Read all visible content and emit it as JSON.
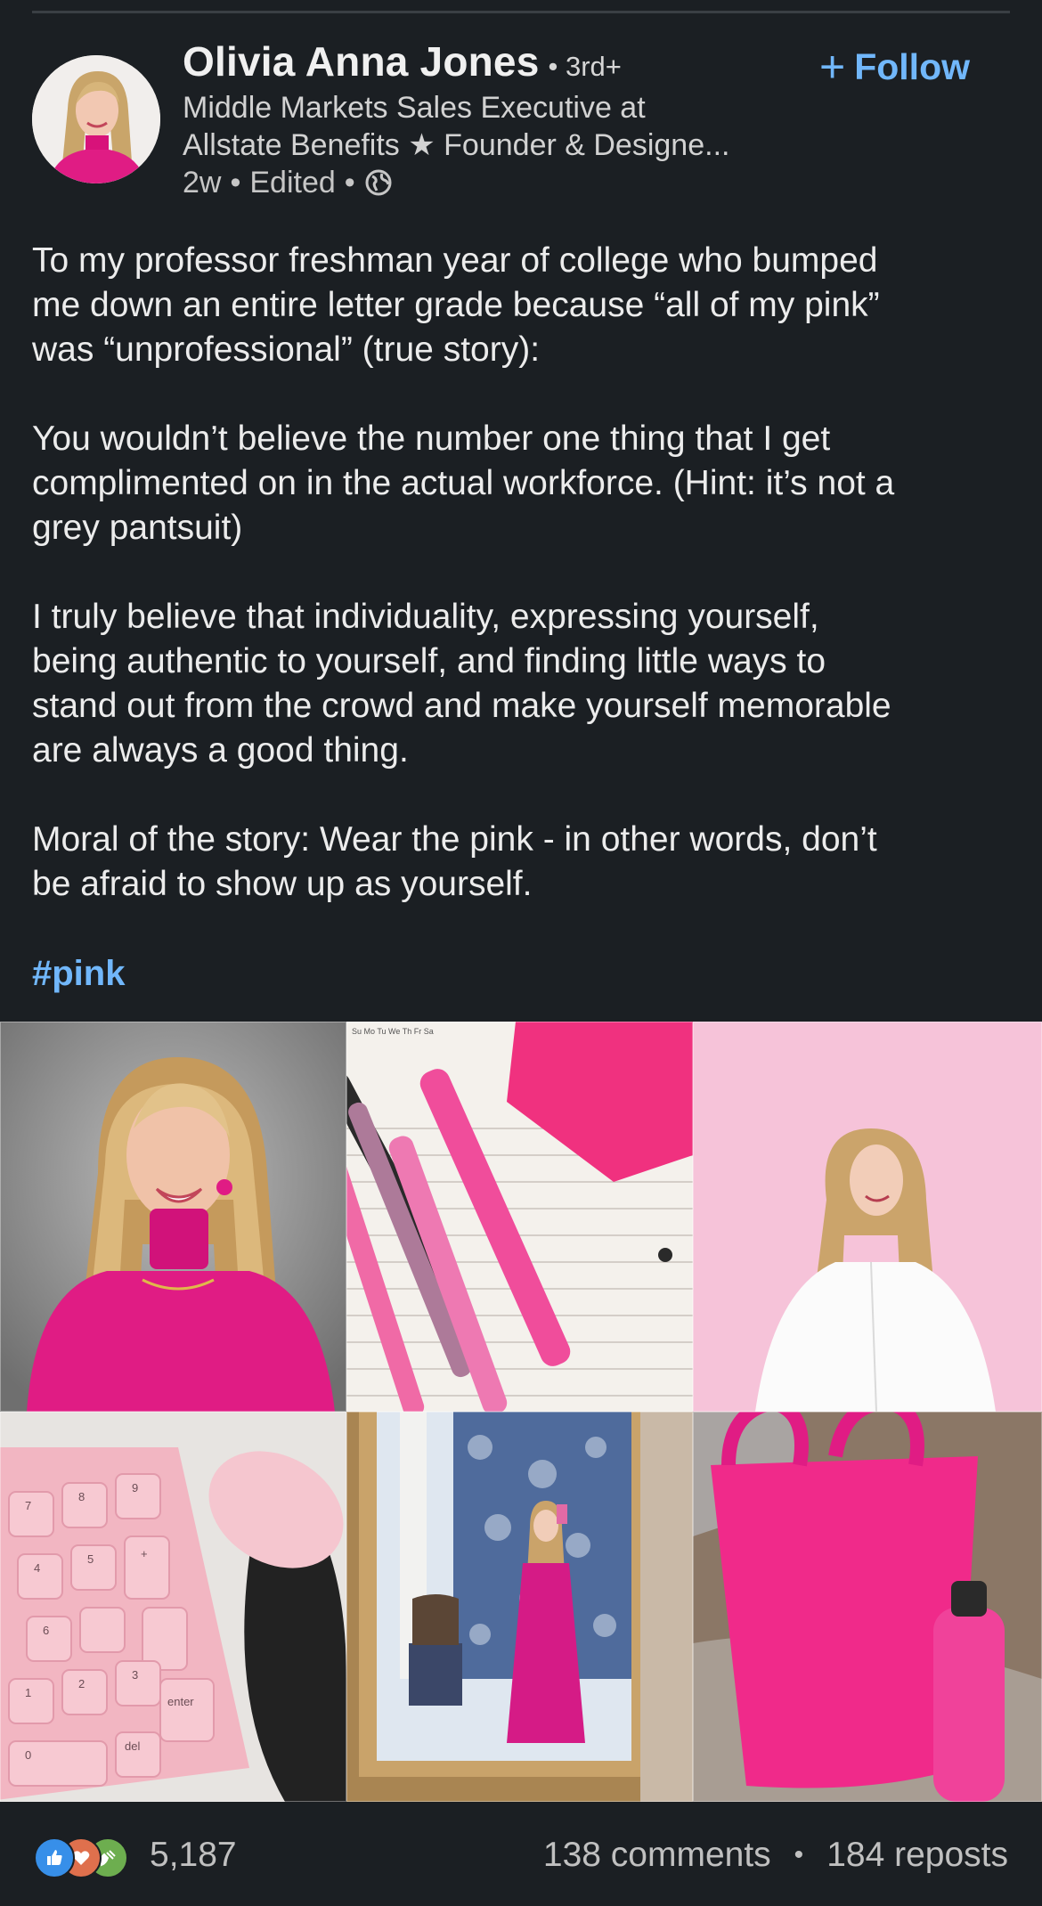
{
  "post": {
    "author": {
      "name": "Olivia Anna Jones",
      "degree": "• 3rd+",
      "headline_line1": "Middle Markets Sales Executive at",
      "headline_line2": "Allstate Benefits ★ Founder & Designe...",
      "time": "2w",
      "edited": "Edited",
      "visibility_icon": "globe-icon"
    },
    "follow_label": "Follow",
    "body": {
      "p1": [
        "To my professor freshman year of college who bumped",
        "me down an entire letter grade because “all of my pink”",
        "was “unprofessional” (true story):"
      ],
      "p2": [
        "You wouldn’t believe the number one thing that I get",
        "complimented on in the actual workforce. (Hint: it’s not a",
        "grey pantsuit)"
      ],
      "p3": [
        "I truly believe that individuality, expressing yourself,",
        "being authentic to yourself, and finding little ways to",
        "stand out from the crowd and make yourself memorable",
        "are always a good thing."
      ],
      "p4": [
        "Moral of the story: Wear the pink - in other words, don’t",
        "be afraid to show up as yourself."
      ]
    },
    "hashtag": "#pink",
    "photos": [
      {
        "subject": "headshot-pink-turtleneck"
      },
      {
        "subject": "pink-pens-and-notebook",
        "calendar_header": "Su Mo Tu We Th Fr Sa"
      },
      {
        "subject": "woman-white-shirt-pink-background"
      },
      {
        "subject": "pink-keypad-and-mouse",
        "keys": [
          "7",
          "8",
          "9",
          "+",
          "4",
          "5",
          "6",
          "1",
          "2",
          "3",
          "enter",
          "0",
          "del"
        ]
      },
      {
        "subject": "mirror-selfie-pink-dress"
      },
      {
        "subject": "pink-tote-bag-and-bottle"
      }
    ],
    "social": {
      "reaction_icons": [
        "like-icon",
        "love-icon",
        "celebrate-icon"
      ],
      "reaction_count": "5,187",
      "comments": "138 comments",
      "separator": "•",
      "reposts": "184 reposts"
    },
    "colors": {
      "background": "#1b1f23",
      "link": "#71b7fb",
      "text": "#ececec",
      "pink": "#e01c84"
    }
  }
}
